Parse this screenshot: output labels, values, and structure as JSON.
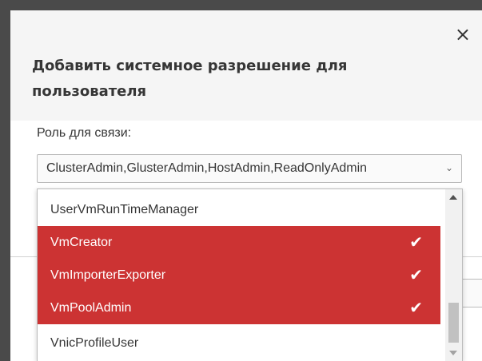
{
  "dialog": {
    "title": "Добавить системное разрешение для пользователя",
    "close_symbol": "×",
    "role_label": "Роль для связи:"
  },
  "role_select": {
    "value": "ClusterAdmin,GlusterAdmin,HostAdmin,ReadOnlyAdmin",
    "caret_symbol": "⌄"
  },
  "options": [
    {
      "label": "UserVmRunTimeManager",
      "selected": false
    },
    {
      "label": "VmCreator",
      "selected": true,
      "check": "✔"
    },
    {
      "label": "VmImporterExporter",
      "selected": true,
      "check": "✔"
    },
    {
      "label": "VmPoolAdmin",
      "selected": true,
      "check": "✔"
    },
    {
      "label": "VnicProfileUser",
      "selected": false
    }
  ],
  "colors": {
    "selected_bg": "#cc3333",
    "header_bg": "#f5f5f5",
    "overlay_bg": "#4a4a4a"
  },
  "icons": [
    "close-icon",
    "chevron-down-icon",
    "checkmark-icon",
    "scroll-up-arrow-icon",
    "scroll-down-arrow-icon"
  ]
}
